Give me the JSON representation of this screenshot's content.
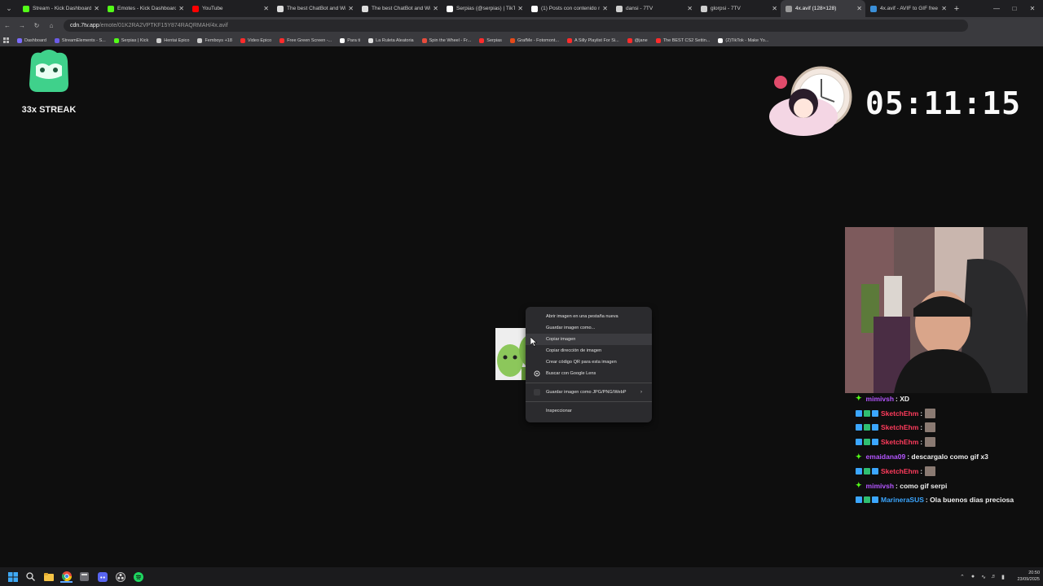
{
  "browser": {
    "tabs": [
      {
        "title": "Stream - Kick Dashboard",
        "favicon_color": "#53fc18"
      },
      {
        "title": "Emotes - Kick Dashboard",
        "favicon_color": "#53fc18"
      },
      {
        "title": "YouTube",
        "favicon_color": "#ff0000"
      },
      {
        "title": "The best ChatBot and Wi",
        "favicon_color": "#dddddd"
      },
      {
        "title": "The best ChatBot and Wi",
        "favicon_color": "#dddddd"
      },
      {
        "title": "Serpias (@serpias) | TikTo",
        "favicon_color": "#ffffff"
      },
      {
        "title": "(1) Posts con contenido m",
        "favicon_color": "#ffffff"
      },
      {
        "title": "dansi - 7TV",
        "favicon_color": "#cfcfcf"
      },
      {
        "title": "glorpsi - 7TV",
        "favicon_color": "#cfcfcf"
      },
      {
        "title": "4x.avif (128×128)",
        "favicon_color": "#9a9a9a",
        "active": true
      },
      {
        "title": "4x.avif - AVIF to GIF free o",
        "favicon_color": "#3a8fd8"
      }
    ],
    "address": {
      "host": "cdn.7tv.app",
      "path": "/emote/01K2RA2VPTKF15Y874RAQRMAH/4x.avif"
    },
    "bookmarks": [
      {
        "label": "Dashboard",
        "color": "#7c6cff"
      },
      {
        "label": "StreamElements - S...",
        "color": "#6c5ce7"
      },
      {
        "label": "Serpias | Kick",
        "color": "#53fc18"
      },
      {
        "label": "Hentai Epico",
        "color": "#cccccc"
      },
      {
        "label": "Femboys +18",
        "color": "#cccccc"
      },
      {
        "label": "Video Epico",
        "color": "#ff2b2b"
      },
      {
        "label": "Free Green Screen -...",
        "color": "#ff2b2b"
      },
      {
        "label": "Para ti",
        "color": "#ffffff"
      },
      {
        "label": "La Ruleta Aleatoria",
        "color": "#e0e0e0"
      },
      {
        "label": "Spin the Wheel - Fr...",
        "color": "#e74c3c"
      },
      {
        "label": "Serpias",
        "color": "#ff2b2b"
      },
      {
        "label": "GrafMe - Fotomont...",
        "color": "#e64a19"
      },
      {
        "label": "A Silly Playlist For Si...",
        "color": "#ff2b2b"
      },
      {
        "label": "@jane",
        "color": "#ff2b2b"
      },
      {
        "label": "The BEST CS2 Settin...",
        "color": "#ff2b2b"
      },
      {
        "label": "(2)TikTok - Make Yo...",
        "color": "#ffffff"
      }
    ]
  },
  "overlay": {
    "streak_label": "33x STREAK",
    "timer": "05:11:15"
  },
  "context_menu": {
    "items": [
      {
        "label": "Abrir imagen en una pestaña nueva"
      },
      {
        "label": "Guardar imagen como..."
      },
      {
        "label": "Copiar imagen",
        "hover": true
      },
      {
        "label": "Copiar dirección de imagen"
      },
      {
        "label": "Crear código QR para esta imagen"
      },
      {
        "label": "Buscar con Google Lens",
        "icon": "google-lens-icon"
      }
    ],
    "extension_item": {
      "label": "Guardar imagen como JPG/PNG/WebP",
      "has_submenu": true
    },
    "inspect_item": {
      "label": "Inspeccionar"
    }
  },
  "chat": {
    "messages": [
      {
        "user": "mimivsh",
        "color": "#b455ff",
        "text": ": XD",
        "emote": false
      },
      {
        "user": "SketchEhm",
        "color": "#ff3b5c",
        "text": ":",
        "emote": true
      },
      {
        "user": "SketchEhm",
        "color": "#ff3b5c",
        "text": ":",
        "emote": true
      },
      {
        "user": "SketchEhm",
        "color": "#ff3b5c",
        "text": ":",
        "emote": true
      },
      {
        "user": "emaidana09",
        "color": "#b455ff",
        "text": ": descargalo como gif x3",
        "emote": false
      },
      {
        "user": "SketchEhm",
        "color": "#ff3b5c",
        "text": ":",
        "emote": true
      },
      {
        "user": "mimivsh",
        "color": "#b455ff",
        "text": ": como gif serpi",
        "emote": false
      },
      {
        "user": "MarineraSUS",
        "color": "#3ba6ff",
        "text": ": Ola buenos dias preciosa",
        "emote": false
      }
    ]
  },
  "taskbar": {
    "time": "20:50",
    "date": "23/09/2025"
  }
}
